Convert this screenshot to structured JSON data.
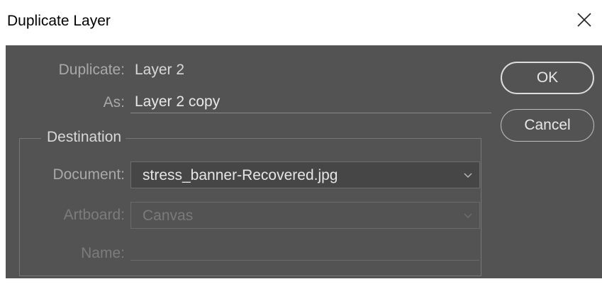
{
  "dialog": {
    "title": "Duplicate Layer",
    "close_icon": "close-icon"
  },
  "form": {
    "duplicate_label": "Duplicate:",
    "duplicate_value": "Layer 2",
    "as_label": "As:",
    "as_value": "Layer 2 copy",
    "destination_legend": "Destination",
    "document_label": "Document:",
    "document_value": "stress_banner-Recovered.jpg",
    "artboard_label": "Artboard:",
    "artboard_value": "Canvas",
    "name_label": "Name:",
    "name_value": ""
  },
  "buttons": {
    "ok": "OK",
    "cancel": "Cancel"
  }
}
